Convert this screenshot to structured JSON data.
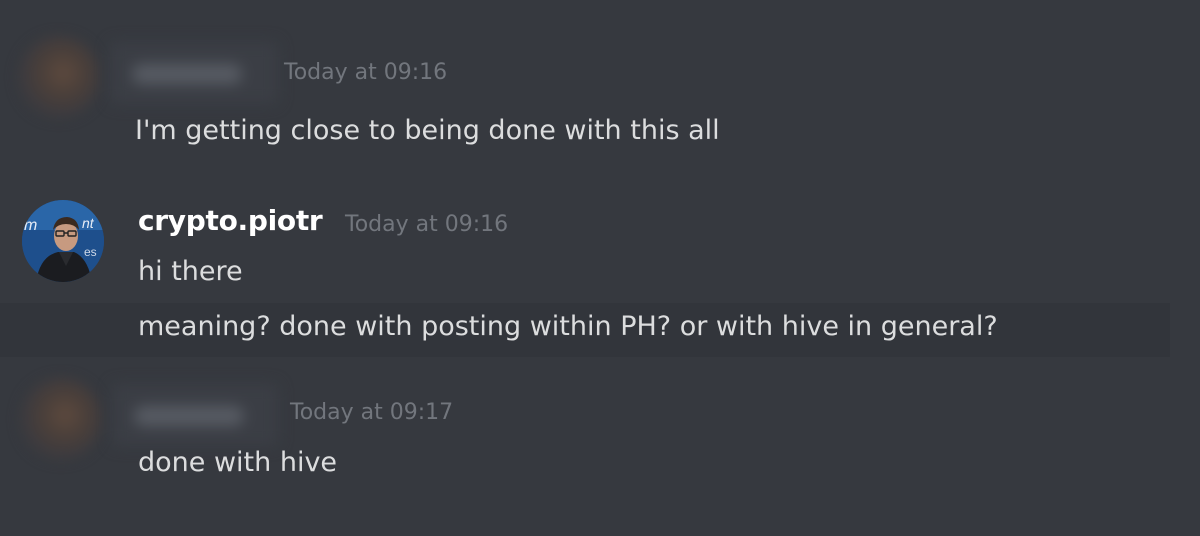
{
  "messages": [
    {
      "author_blurred": true,
      "timestamp": "Today at 09:16",
      "lines": [
        "I'm getting close to being done with this all"
      ]
    },
    {
      "author": "crypto.piotr",
      "timestamp": "Today at 09:16",
      "lines": [
        "hi there",
        "meaning? done with posting within PH? or with hive in general?"
      ]
    },
    {
      "author_blurred": true,
      "timestamp": "Today at 09:17",
      "lines": [
        "done with hive"
      ]
    }
  ],
  "colors": {
    "background": "#36393f",
    "username": "#ffffff",
    "timestamp": "#72767d",
    "message_text": "#dcddde"
  }
}
